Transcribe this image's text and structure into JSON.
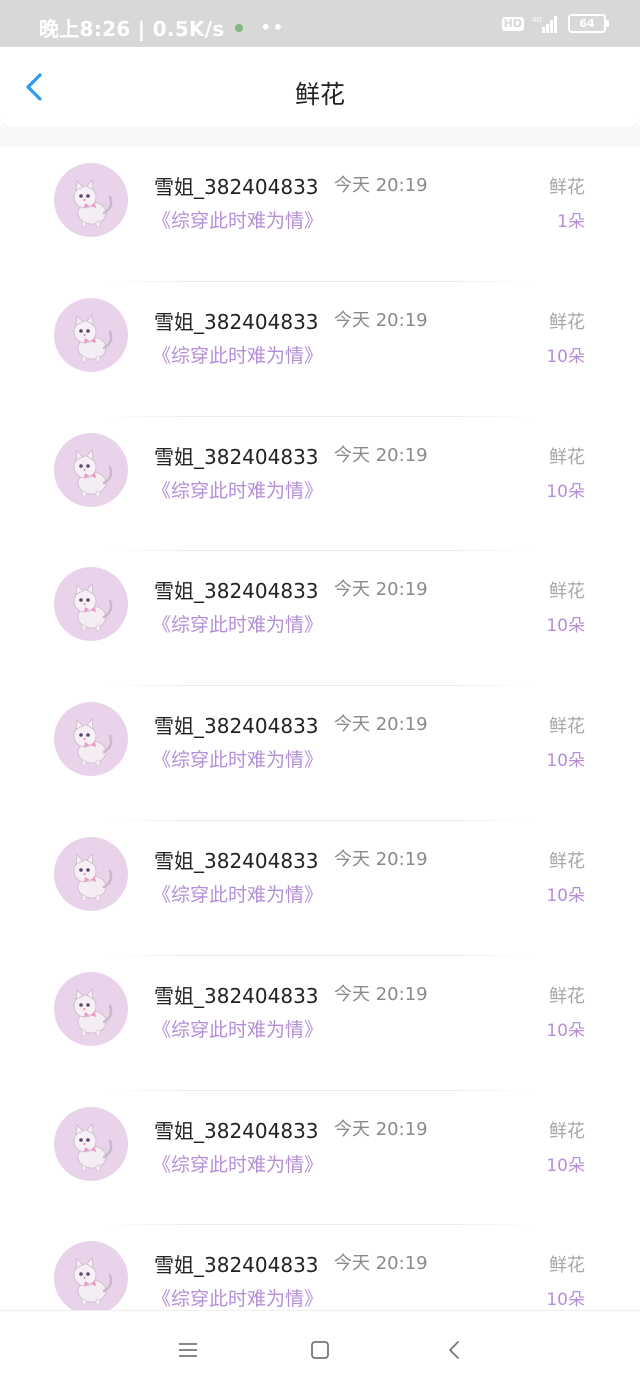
{
  "status_bar": {
    "time_speed": "晚上8:26 | 0.5K/s",
    "more": "••",
    "hd": "HD",
    "network": "4G",
    "battery": "64"
  },
  "header": {
    "title": "鲜花",
    "back_icon": "chevron-left-icon"
  },
  "records": [
    {
      "user": "雪姐_382404833",
      "time": "今天 20:19",
      "book": "《综穿此时难为情》",
      "gift": "鲜花",
      "count": "1朵"
    },
    {
      "user": "雪姐_382404833",
      "time": "今天 20:19",
      "book": "《综穿此时难为情》",
      "gift": "鲜花",
      "count": "10朵"
    },
    {
      "user": "雪姐_382404833",
      "time": "今天 20:19",
      "book": "《综穿此时难为情》",
      "gift": "鲜花",
      "count": "10朵"
    },
    {
      "user": "雪姐_382404833",
      "time": "今天 20:19",
      "book": "《综穿此时难为情》",
      "gift": "鲜花",
      "count": "10朵"
    },
    {
      "user": "雪姐_382404833",
      "time": "今天 20:19",
      "book": "《综穿此时难为情》",
      "gift": "鲜花",
      "count": "10朵"
    },
    {
      "user": "雪姐_382404833",
      "time": "今天 20:19",
      "book": "《综穿此时难为情》",
      "gift": "鲜花",
      "count": "10朵"
    },
    {
      "user": "雪姐_382404833",
      "time": "今天 20:19",
      "book": "《综穿此时难为情》",
      "gift": "鲜花",
      "count": "10朵"
    },
    {
      "user": "雪姐_382404833",
      "time": "今天 20:19",
      "book": "《综穿此时难为情》",
      "gift": "鲜花",
      "count": "10朵"
    },
    {
      "user": "雪姐_382404833",
      "time": "今天 20:19",
      "book": "《综穿此时难为情》",
      "gift": "鲜花",
      "count": "10朵"
    }
  ],
  "bottom_nav": {
    "menu_icon": "menu-icon",
    "home_icon": "home-square-icon",
    "back_icon": "back-arrow-icon"
  },
  "colors": {
    "accent_purple": "#b58fd6",
    "back_blue": "#2b9bf0",
    "avatar_bg": "#e9d3ea"
  }
}
